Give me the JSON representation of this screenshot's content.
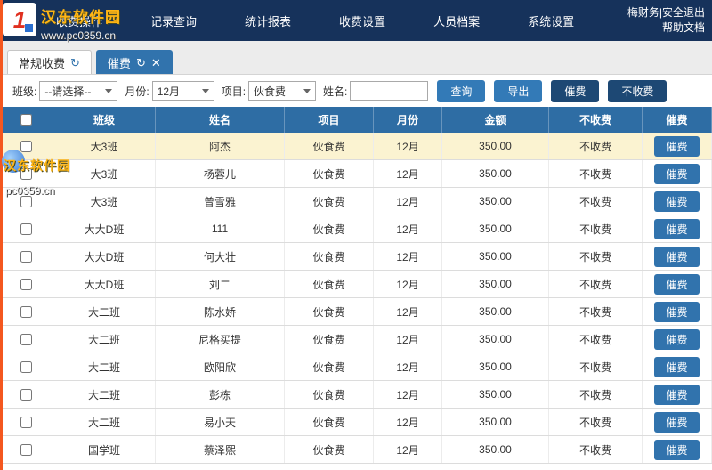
{
  "colors": {
    "navbar_bg": "#16325b",
    "table_header_bg": "#2e6da4",
    "button_primary": "#337ab7",
    "button_dark": "#1d4874",
    "row_highlight": "#fbf3d1",
    "urge_button": "#3173ad",
    "left_strip": "#f4571f",
    "watermark_yellow": "#ffb514"
  },
  "navbar": {
    "items": [
      "收费操作",
      "记录查询",
      "统计报表",
      "收费设置",
      "人员档案",
      "系统设置"
    ],
    "account": "梅财务|安全退出",
    "help": "帮助文档"
  },
  "tabs": [
    {
      "label": "常规收费",
      "active": true
    },
    {
      "label": "催费",
      "active": false
    }
  ],
  "filters": {
    "class_label": "班级:",
    "class_value": "--请选择--",
    "month_label": "月份:",
    "month_value": "12月",
    "project_label": "项目:",
    "project_value": "伙食费",
    "name_label": "姓名:",
    "name_value": "",
    "buttons": {
      "query": "查询",
      "export": "导出",
      "urge": "催费",
      "nofee": "不收费"
    }
  },
  "table": {
    "headers": [
      "班级",
      "姓名",
      "项目",
      "月份",
      "金额",
      "不收费",
      "催费"
    ],
    "rows": [
      {
        "class": "大3班",
        "name": "阿杰",
        "project": "伙食费",
        "month": "12月",
        "amount": "350.00",
        "nofee": "不收费",
        "urge": "催费",
        "highlight": true
      },
      {
        "class": "大3班",
        "name": "杨蓉儿",
        "project": "伙食费",
        "month": "12月",
        "amount": "350.00",
        "nofee": "不收费",
        "urge": "催费",
        "highlight": false
      },
      {
        "class": "大3班",
        "name": "曾雪雅",
        "project": "伙食费",
        "month": "12月",
        "amount": "350.00",
        "nofee": "不收费",
        "urge": "催费",
        "highlight": false
      },
      {
        "class": "大大D班",
        "name": "111",
        "project": "伙食费",
        "month": "12月",
        "amount": "350.00",
        "nofee": "不收费",
        "urge": "催费",
        "highlight": false
      },
      {
        "class": "大大D班",
        "name": "何大壮",
        "project": "伙食费",
        "month": "12月",
        "amount": "350.00",
        "nofee": "不收费",
        "urge": "催费",
        "highlight": false
      },
      {
        "class": "大大D班",
        "name": "刘二",
        "project": "伙食费",
        "month": "12月",
        "amount": "350.00",
        "nofee": "不收费",
        "urge": "催费",
        "highlight": false
      },
      {
        "class": "大二班",
        "name": "陈水娇",
        "project": "伙食费",
        "month": "12月",
        "amount": "350.00",
        "nofee": "不收费",
        "urge": "催费",
        "highlight": false
      },
      {
        "class": "大二班",
        "name": "尼格买提",
        "project": "伙食费",
        "month": "12月",
        "amount": "350.00",
        "nofee": "不收费",
        "urge": "催费",
        "highlight": false
      },
      {
        "class": "大二班",
        "name": "欧阳欣",
        "project": "伙食费",
        "month": "12月",
        "amount": "350.00",
        "nofee": "不收费",
        "urge": "催费",
        "highlight": false
      },
      {
        "class": "大二班",
        "name": "彭栋",
        "project": "伙食费",
        "month": "12月",
        "amount": "350.00",
        "nofee": "不收费",
        "urge": "催费",
        "highlight": false
      },
      {
        "class": "大二班",
        "name": "易小天",
        "project": "伙食费",
        "month": "12月",
        "amount": "350.00",
        "nofee": "不收费",
        "urge": "催费",
        "highlight": false
      },
      {
        "class": "国学班",
        "name": "蔡泽熙",
        "project": "伙食费",
        "month": "12月",
        "amount": "350.00",
        "nofee": "不收费",
        "urge": "催费",
        "highlight": false
      }
    ]
  },
  "watermark": {
    "logo_text": "1",
    "site_name": "汉东软件园",
    "site_url": "www.pc0359.cn",
    "site_url_short": "pc0359.cn"
  }
}
